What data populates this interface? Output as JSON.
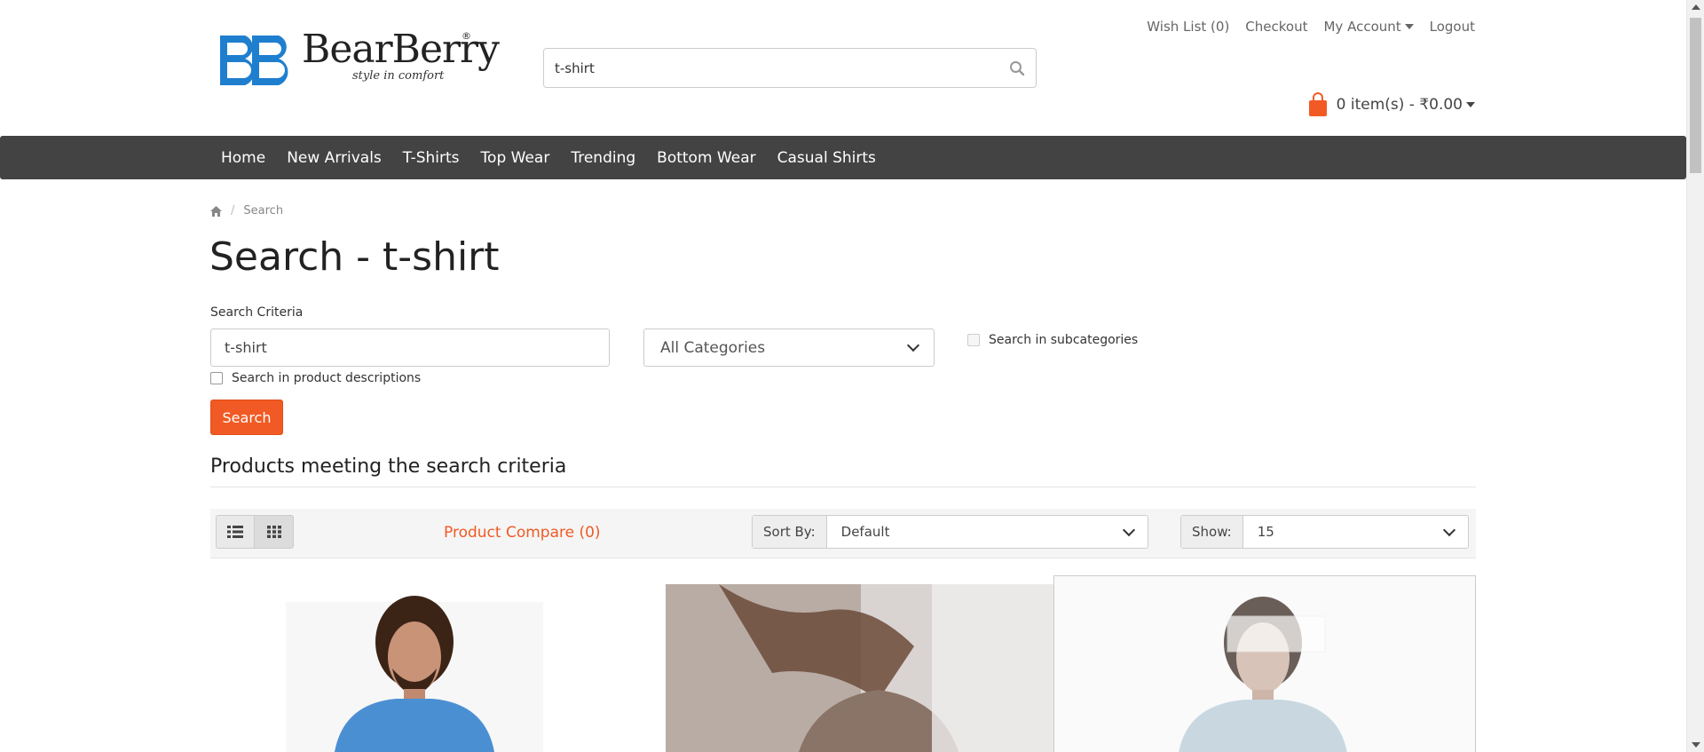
{
  "brand": {
    "name": "BearBerry",
    "registered": "®",
    "tagline": "style in comfort"
  },
  "header": {
    "search_value": "t-shirt",
    "links": {
      "wishlist": "Wish List (0)",
      "checkout": "Checkout",
      "account": "My Account",
      "logout": "Logout"
    },
    "cart": "0 item(s) - ₹0.00"
  },
  "nav": {
    "items": [
      "Home",
      "New Arrivals",
      "T-Shirts",
      "Top Wear",
      "Trending",
      "Bottom Wear",
      "Casual Shirts"
    ]
  },
  "breadcrumb": {
    "current": "Search"
  },
  "page": {
    "title": "Search - t-shirt"
  },
  "search_form": {
    "criteria_label": "Search Criteria",
    "criteria_value": "t-shirt",
    "category_selected": "All Categories",
    "subcategories_label": "Search in subcategories",
    "descriptions_label": "Search in product descriptions",
    "button_label": "Search"
  },
  "results": {
    "heading": "Products meeting the search criteria",
    "compare_link": "Product Compare (0)",
    "sort_label": "Sort By:",
    "sort_value": "Default",
    "show_label": "Show:",
    "show_value": "15"
  },
  "colors": {
    "accent": "#f15a24",
    "navbar": "#434343",
    "brand_blue": "#1f7fcf"
  },
  "icons": [
    "home-icon",
    "search-icon",
    "cart-icon",
    "list-view-icon",
    "grid-view-icon"
  ]
}
